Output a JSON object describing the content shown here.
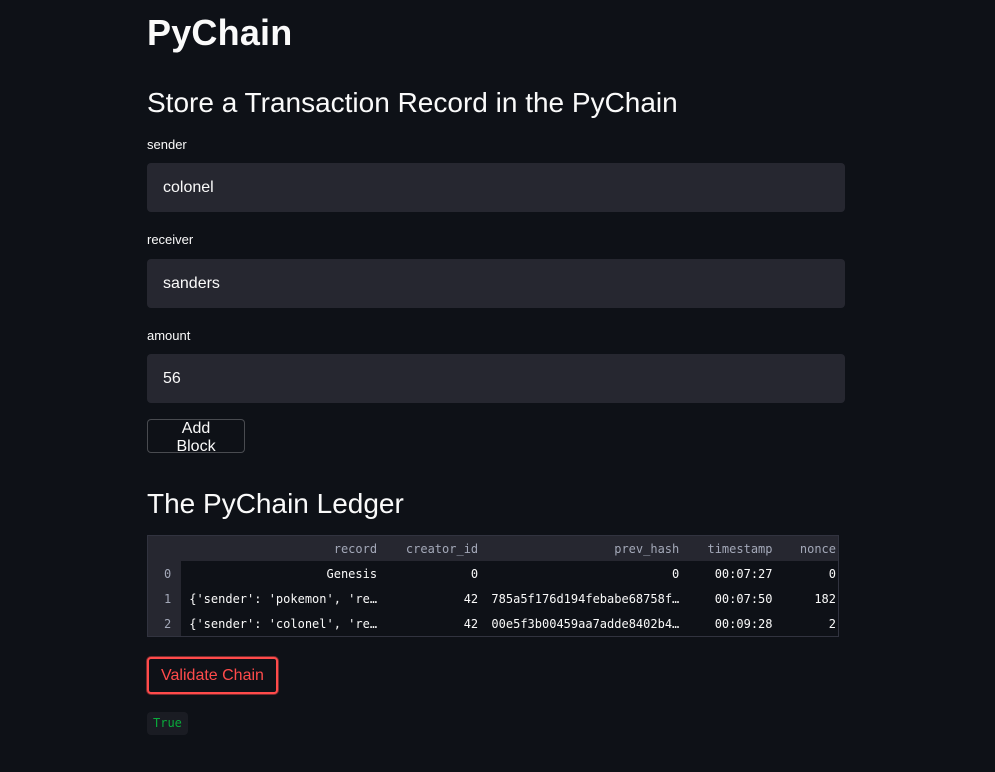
{
  "app": {
    "title": "PyChain"
  },
  "form": {
    "title": "Store a Transaction Record in the PyChain",
    "fields": [
      {
        "label": "sender",
        "value": "colonel"
      },
      {
        "label": "receiver",
        "value": "sanders"
      },
      {
        "label": "amount",
        "value": "56"
      }
    ],
    "submit_label": "Add Block"
  },
  "ledger": {
    "title": "The PyChain Ledger",
    "columns": [
      "",
      "record",
      "creator_id",
      "prev_hash",
      "timestamp",
      "nonce"
    ],
    "rows": [
      {
        "index": "0",
        "record": "Genesis",
        "creator_id": "0",
        "prev_hash": "0",
        "timestamp": "00:07:27",
        "nonce": "0"
      },
      {
        "index": "1",
        "record": "{'sender': 'pokemon', 're…",
        "creator_id": "42",
        "prev_hash": "785a5f176d194febabe68758f…",
        "timestamp": "00:07:50",
        "nonce": "182"
      },
      {
        "index": "2",
        "record": "{'sender': 'colonel', 're…",
        "creator_id": "42",
        "prev_hash": "00e5f3b00459aa7adde8402b4…",
        "timestamp": "00:09:28",
        "nonce": "2"
      }
    ]
  },
  "validate": {
    "label": "Validate Chain",
    "result": "True"
  },
  "colors": {
    "background": "#0e1117",
    "input_background": "#262730",
    "accent": "#ff4b4b",
    "success": "#09ab3b"
  }
}
